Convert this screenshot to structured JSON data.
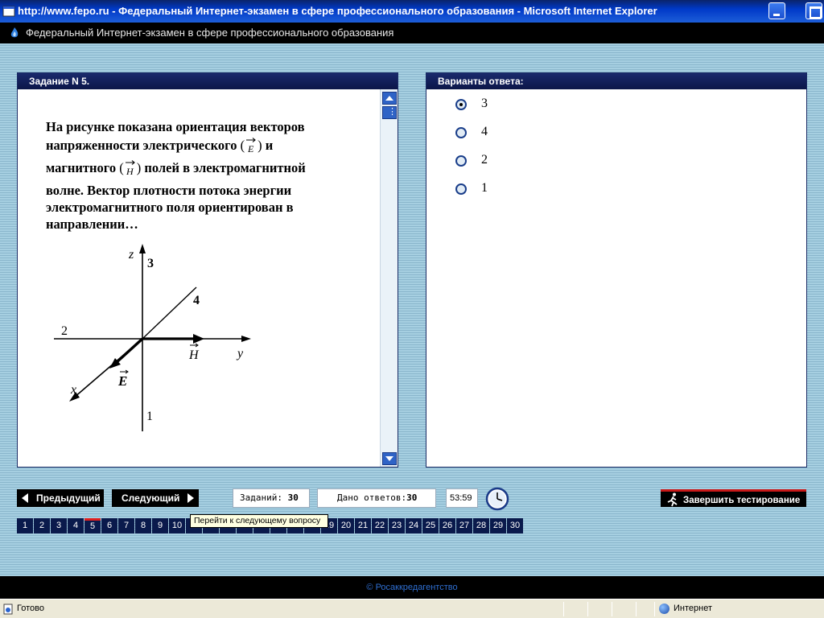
{
  "window": {
    "title": "http://www.fepo.ru - Федеральный Интернет-экзамен в сфере профессионального образования - Microsoft Internet Explorer"
  },
  "app": {
    "header": "Федеральный Интернет-экзамен в сфере профессионального образования",
    "footer": "© Росаккредагентство"
  },
  "task": {
    "title": "Задание N 5.",
    "line1": "На рисунке показана ориентация векторов",
    "line2a": "напряженности электрического",
    "line2b": "и",
    "line3a": "магнитного",
    "line3b": "полей в электромагнитной",
    "line4": "волне. Вектор плотности потока энергии",
    "line5": "электромагнитного поля ориентирован в",
    "line6": "направлении…",
    "e_symbol": "E",
    "h_symbol": "H",
    "figure": {
      "label_z": "z",
      "label_y": "y",
      "label_x": "x",
      "label_1": "1",
      "label_2": "2",
      "label_3": "3",
      "label_4": "4",
      "label_E": "E",
      "label_H": "H"
    }
  },
  "answers": {
    "title": "Варианты ответа:",
    "options": [
      {
        "label": "3",
        "checked": true
      },
      {
        "label": "4",
        "checked": false
      },
      {
        "label": "2",
        "checked": false
      },
      {
        "label": "1",
        "checked": false
      }
    ]
  },
  "toolbar": {
    "prev_label": "Предыдущий",
    "next_label": "Следующий",
    "total_label": "Заданий:",
    "total_value": "30",
    "answered_label": "Дано ответов:",
    "answered_value": "30",
    "timer": "53:59",
    "finish_label": "Завершить тестирование",
    "tooltip": "Перейти к следующему вопросу"
  },
  "question_numbers": [
    "1",
    "2",
    "3",
    "4",
    "5",
    "6",
    "7",
    "8",
    "9",
    "10",
    "11",
    "12",
    "13",
    "14",
    "15",
    "16",
    "17",
    "18",
    "19",
    "20",
    "21",
    "22",
    "23",
    "24",
    "25",
    "26",
    "27",
    "28",
    "29",
    "30"
  ],
  "current_question": "5",
  "status": {
    "left": "Готово",
    "zone": "Интернет"
  }
}
